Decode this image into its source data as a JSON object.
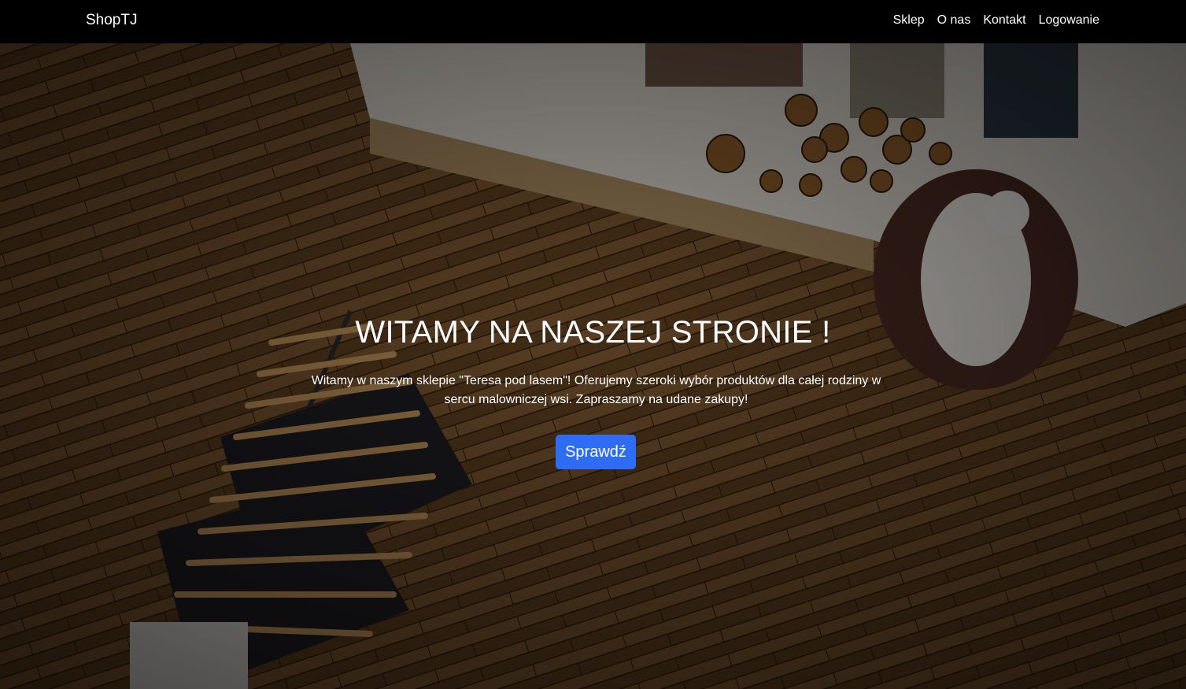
{
  "navbar": {
    "brand": "ShopTJ",
    "links": [
      {
        "label": "Sklep"
      },
      {
        "label": "O nas"
      },
      {
        "label": "Kontakt"
      },
      {
        "label": "Logowanie"
      }
    ]
  },
  "hero": {
    "title": "WITAMY NA NASZEJ STRONIE !",
    "text": "Witamy w naszym sklepie \"Teresa pod lasem\"! Oferujemy szeroki wybór produktów dla całej rodziny w sercu malowniczej wsi. Zapraszamy na udane zakupy!",
    "button_label": "Sprawdź"
  },
  "colors": {
    "navbar_bg": "#000000",
    "button_bg": "#2f6cf6",
    "text": "#ffffff"
  }
}
